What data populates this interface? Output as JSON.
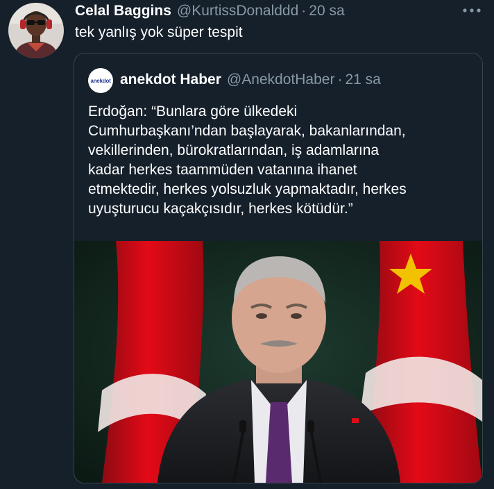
{
  "tweet": {
    "display_name": "Celal Baggins",
    "handle": "@KurtissDonalddd",
    "separator": "·",
    "time": "20 sa",
    "text": "tek yanlış yok süper tespit"
  },
  "quote": {
    "avatar_label": "anekdot",
    "display_name": "anekdot Haber",
    "handle": "@AnekdotHaber",
    "separator": "·",
    "time": "21 sa",
    "text_lines": [
      "Erdoğan: “Bunlara göre ülkedeki",
      "Cumhurbaşkanı’ndan başlayarak, bakanlarından,",
      "vekillerinden, bürokratlarından, iş adamlarına",
      "kadar herkes taammüden vatanına ihanet",
      "etmektedir, herkes yolsuzluk yapmaktadır, herkes",
      "uyuşturucu kaçakçısıdır, herkes kötüdür.”"
    ]
  },
  "colors": {
    "background": "#15202b",
    "secondary_text": "#8899a6",
    "border": "#38444d",
    "flag_red": "#e30a17"
  },
  "icons": {
    "more": "more-horizontal-icon",
    "flag_star": "star-icon"
  }
}
